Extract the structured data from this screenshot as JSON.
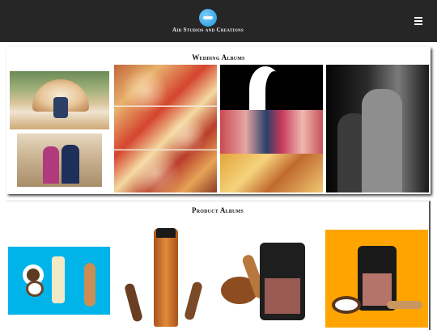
{
  "header": {
    "brand_name": "Air Studios and Creations",
    "logo_icon": "air-studios-logo",
    "menu_icon": "hamburger-menu-icon",
    "background_color": "#262626"
  },
  "sections": {
    "wedding": {
      "title": "Wedding Albums"
    },
    "product": {
      "title": "Product Albums"
    }
  }
}
